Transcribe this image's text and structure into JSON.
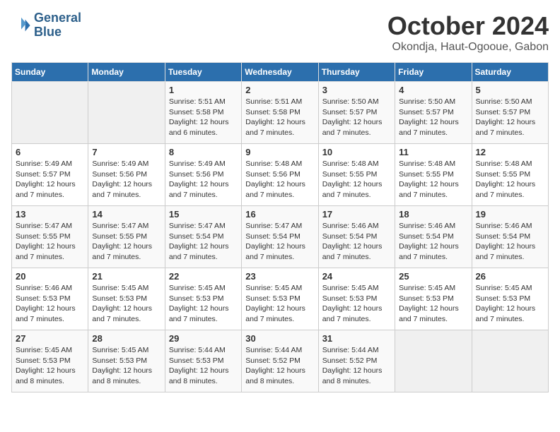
{
  "header": {
    "logo_line1": "General",
    "logo_line2": "Blue",
    "month": "October 2024",
    "location": "Okondja, Haut-Ogooue, Gabon"
  },
  "days_of_week": [
    "Sunday",
    "Monday",
    "Tuesday",
    "Wednesday",
    "Thursday",
    "Friday",
    "Saturday"
  ],
  "weeks": [
    [
      {
        "day": "",
        "info": ""
      },
      {
        "day": "",
        "info": ""
      },
      {
        "day": "1",
        "info": "Sunrise: 5:51 AM\nSunset: 5:58 PM\nDaylight: 12 hours\nand 6 minutes."
      },
      {
        "day": "2",
        "info": "Sunrise: 5:51 AM\nSunset: 5:58 PM\nDaylight: 12 hours\nand 7 minutes."
      },
      {
        "day": "3",
        "info": "Sunrise: 5:50 AM\nSunset: 5:57 PM\nDaylight: 12 hours\nand 7 minutes."
      },
      {
        "day": "4",
        "info": "Sunrise: 5:50 AM\nSunset: 5:57 PM\nDaylight: 12 hours\nand 7 minutes."
      },
      {
        "day": "5",
        "info": "Sunrise: 5:50 AM\nSunset: 5:57 PM\nDaylight: 12 hours\nand 7 minutes."
      }
    ],
    [
      {
        "day": "6",
        "info": "Sunrise: 5:49 AM\nSunset: 5:57 PM\nDaylight: 12 hours\nand 7 minutes."
      },
      {
        "day": "7",
        "info": "Sunrise: 5:49 AM\nSunset: 5:56 PM\nDaylight: 12 hours\nand 7 minutes."
      },
      {
        "day": "8",
        "info": "Sunrise: 5:49 AM\nSunset: 5:56 PM\nDaylight: 12 hours\nand 7 minutes."
      },
      {
        "day": "9",
        "info": "Sunrise: 5:48 AM\nSunset: 5:56 PM\nDaylight: 12 hours\nand 7 minutes."
      },
      {
        "day": "10",
        "info": "Sunrise: 5:48 AM\nSunset: 5:55 PM\nDaylight: 12 hours\nand 7 minutes."
      },
      {
        "day": "11",
        "info": "Sunrise: 5:48 AM\nSunset: 5:55 PM\nDaylight: 12 hours\nand 7 minutes."
      },
      {
        "day": "12",
        "info": "Sunrise: 5:48 AM\nSunset: 5:55 PM\nDaylight: 12 hours\nand 7 minutes."
      }
    ],
    [
      {
        "day": "13",
        "info": "Sunrise: 5:47 AM\nSunset: 5:55 PM\nDaylight: 12 hours\nand 7 minutes."
      },
      {
        "day": "14",
        "info": "Sunrise: 5:47 AM\nSunset: 5:55 PM\nDaylight: 12 hours\nand 7 minutes."
      },
      {
        "day": "15",
        "info": "Sunrise: 5:47 AM\nSunset: 5:54 PM\nDaylight: 12 hours\nand 7 minutes."
      },
      {
        "day": "16",
        "info": "Sunrise: 5:47 AM\nSunset: 5:54 PM\nDaylight: 12 hours\nand 7 minutes."
      },
      {
        "day": "17",
        "info": "Sunrise: 5:46 AM\nSunset: 5:54 PM\nDaylight: 12 hours\nand 7 minutes."
      },
      {
        "day": "18",
        "info": "Sunrise: 5:46 AM\nSunset: 5:54 PM\nDaylight: 12 hours\nand 7 minutes."
      },
      {
        "day": "19",
        "info": "Sunrise: 5:46 AM\nSunset: 5:54 PM\nDaylight: 12 hours\nand 7 minutes."
      }
    ],
    [
      {
        "day": "20",
        "info": "Sunrise: 5:46 AM\nSunset: 5:53 PM\nDaylight: 12 hours\nand 7 minutes."
      },
      {
        "day": "21",
        "info": "Sunrise: 5:45 AM\nSunset: 5:53 PM\nDaylight: 12 hours\nand 7 minutes."
      },
      {
        "day": "22",
        "info": "Sunrise: 5:45 AM\nSunset: 5:53 PM\nDaylight: 12 hours\nand 7 minutes."
      },
      {
        "day": "23",
        "info": "Sunrise: 5:45 AM\nSunset: 5:53 PM\nDaylight: 12 hours\nand 7 minutes."
      },
      {
        "day": "24",
        "info": "Sunrise: 5:45 AM\nSunset: 5:53 PM\nDaylight: 12 hours\nand 7 minutes."
      },
      {
        "day": "25",
        "info": "Sunrise: 5:45 AM\nSunset: 5:53 PM\nDaylight: 12 hours\nand 7 minutes."
      },
      {
        "day": "26",
        "info": "Sunrise: 5:45 AM\nSunset: 5:53 PM\nDaylight: 12 hours\nand 7 minutes."
      }
    ],
    [
      {
        "day": "27",
        "info": "Sunrise: 5:45 AM\nSunset: 5:53 PM\nDaylight: 12 hours\nand 8 minutes."
      },
      {
        "day": "28",
        "info": "Sunrise: 5:45 AM\nSunset: 5:53 PM\nDaylight: 12 hours\nand 8 minutes."
      },
      {
        "day": "29",
        "info": "Sunrise: 5:44 AM\nSunset: 5:53 PM\nDaylight: 12 hours\nand 8 minutes."
      },
      {
        "day": "30",
        "info": "Sunrise: 5:44 AM\nSunset: 5:52 PM\nDaylight: 12 hours\nand 8 minutes."
      },
      {
        "day": "31",
        "info": "Sunrise: 5:44 AM\nSunset: 5:52 PM\nDaylight: 12 hours\nand 8 minutes."
      },
      {
        "day": "",
        "info": ""
      },
      {
        "day": "",
        "info": ""
      }
    ]
  ]
}
